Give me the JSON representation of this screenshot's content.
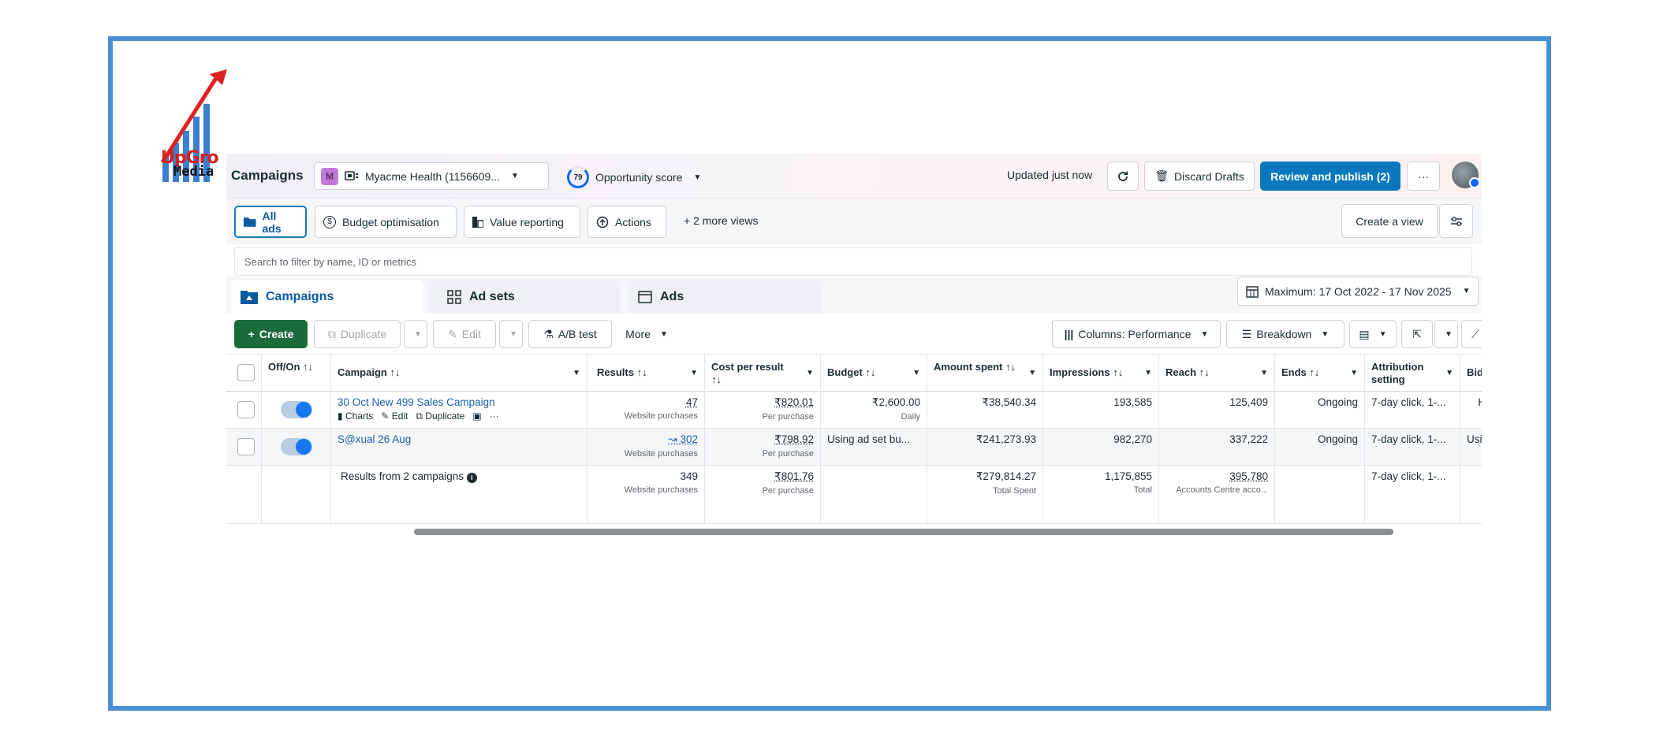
{
  "logo": {
    "line1": "UpGro",
    "line2": "Media"
  },
  "topbar": {
    "title": "Campaigns",
    "account_badge": "M",
    "account_name": "Myacme Health (1156609...",
    "opportunity_value": "79",
    "opportunity_label": "Opportunity score",
    "updated": "Updated just now",
    "discard_label": "Discard Drafts",
    "review_label": "Review and publish (2)",
    "more_label": "···"
  },
  "views": {
    "items": [
      "All ads",
      "Budget optimisation",
      "Value reporting",
      "Actions"
    ],
    "more": "+  2 more views",
    "create_view": "Create a view"
  },
  "search": {
    "placeholder": "Search to filter by name, ID or metrics"
  },
  "tabs": {
    "campaigns": "Campaigns",
    "adsets": "Ad sets",
    "ads": "Ads",
    "date_range": "Maximum: 17 Oct 2022 - 17 Nov 2025"
  },
  "toolbar": {
    "create": "Create",
    "duplicate": "Duplicate",
    "edit": "Edit",
    "ab_test": "A/B test",
    "more": "More",
    "columns": "Columns: Performance",
    "breakdown": "Breakdown"
  },
  "table": {
    "headers": {
      "offon": "Off/On ↑↓",
      "campaign": "Campaign ↑↓",
      "results": "Results ↑↓",
      "cpr": "Cost per result ↑↓",
      "budget": "Budget ↑↓",
      "spent": "Amount spent ↑↓",
      "impressions": "Impressions ↑↓",
      "reach": "Reach ↑↓",
      "ends": "Ends ↑↓",
      "attribution": "Attribution setting",
      "bid": "Bid"
    },
    "rows": [
      {
        "name": "30 Oct New 499 Sales Campaign",
        "row_actions": [
          "Charts",
          "Edit",
          "Duplicate",
          "···"
        ],
        "results": "47",
        "results_sub": "Website purchases",
        "cpr": "₹820.01",
        "cpr_sub": "Per purchase",
        "budget": "₹2,600.00",
        "budget_sub": "Daily",
        "spent": "₹38,540.34",
        "impressions": "193,585",
        "reach": "125,409",
        "ends": "Ongoing",
        "attribution": "7-day click, 1-...",
        "bid": "H"
      },
      {
        "name": "S@xual 26 Aug",
        "results": "↝ 302",
        "results_sub": "Website purchases",
        "cpr": "₹798.92",
        "cpr_sub": "Per purchase",
        "budget": "Using ad set bu...",
        "spent": "₹241,273.93",
        "impressions": "982,270",
        "reach": "337,222",
        "ends": "Ongoing",
        "attribution": "7-day click, 1-...",
        "bid": "Usi"
      }
    ],
    "summary": {
      "label": "Results from 2 campaigns",
      "results": "349",
      "results_sub": "Website purchases",
      "cpr": "₹801.76",
      "cpr_sub": "Per purchase",
      "spent": "₹279,814.27",
      "spent_sub": "Total Spent",
      "impressions": "1,175,855",
      "impressions_sub": "Total",
      "reach": "395,780",
      "reach_sub": "Accounts Centre acco...",
      "attribution": "7-day click, 1-..."
    }
  }
}
